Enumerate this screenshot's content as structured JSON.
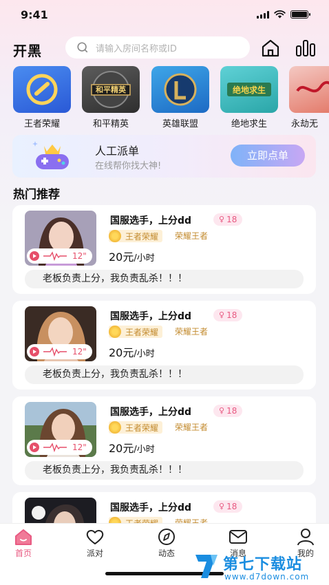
{
  "status_bar": {
    "time": "9:41"
  },
  "header": {
    "logo": "开黑",
    "search_placeholder": "请输入房间名称或ID",
    "search_icon": "search-icon",
    "home_icon": "home-icon",
    "rank_icon": "bar-chart-icon"
  },
  "games": [
    {
      "label": "王者荣耀"
    },
    {
      "label": "和平精英",
      "tile_text": "和平精英"
    },
    {
      "label": "英雄联盟"
    },
    {
      "label": "绝地求生",
      "tile_text": "绝地求生"
    },
    {
      "label": "永劫无"
    }
  ],
  "banner": {
    "title": "人工派单",
    "subtitle": "在线帮你找大神!",
    "button": "立即点单",
    "icon": "gamepad-crown-icon"
  },
  "section_title": "热门推荐",
  "cards": [
    {
      "name": "国服选手，上分dd",
      "age": "18",
      "game": "王者荣耀",
      "rank": "荣耀王者",
      "price": "20元",
      "unit": "/小时",
      "duration": "12\"",
      "motto": "老板负责上分，我负责乱杀！！！"
    },
    {
      "name": "国服选手，上分dd",
      "age": "18",
      "game": "王者荣耀",
      "rank": "荣耀王者",
      "price": "20元",
      "unit": "/小时",
      "duration": "12\"",
      "motto": "老板负责上分，我负责乱杀！！！"
    },
    {
      "name": "国服选手，上分dd",
      "age": "18",
      "game": "王者荣耀",
      "rank": "荣耀王者",
      "price": "20元",
      "unit": "/小时",
      "duration": "12\"",
      "motto": "老板负责上分，我负责乱杀！！！"
    },
    {
      "name": "国服选手，上分dd",
      "age": "18",
      "game": "王者荣耀",
      "rank": "荣耀王者"
    }
  ],
  "tabbar": [
    {
      "label": "首页",
      "icon": "home-icon",
      "active": true
    },
    {
      "label": "派对",
      "icon": "heart-icon"
    },
    {
      "label": "动态",
      "icon": "compass-icon"
    },
    {
      "label": "消息",
      "icon": "mail-icon"
    },
    {
      "label": "我的",
      "icon": "user-icon"
    }
  ],
  "watermark": {
    "title": "第七下载站",
    "url": "www.d7down.com"
  },
  "colors": {
    "accent": "#e85a82",
    "gold": "#c38b2f",
    "primary_button": "#7fb3f8"
  }
}
